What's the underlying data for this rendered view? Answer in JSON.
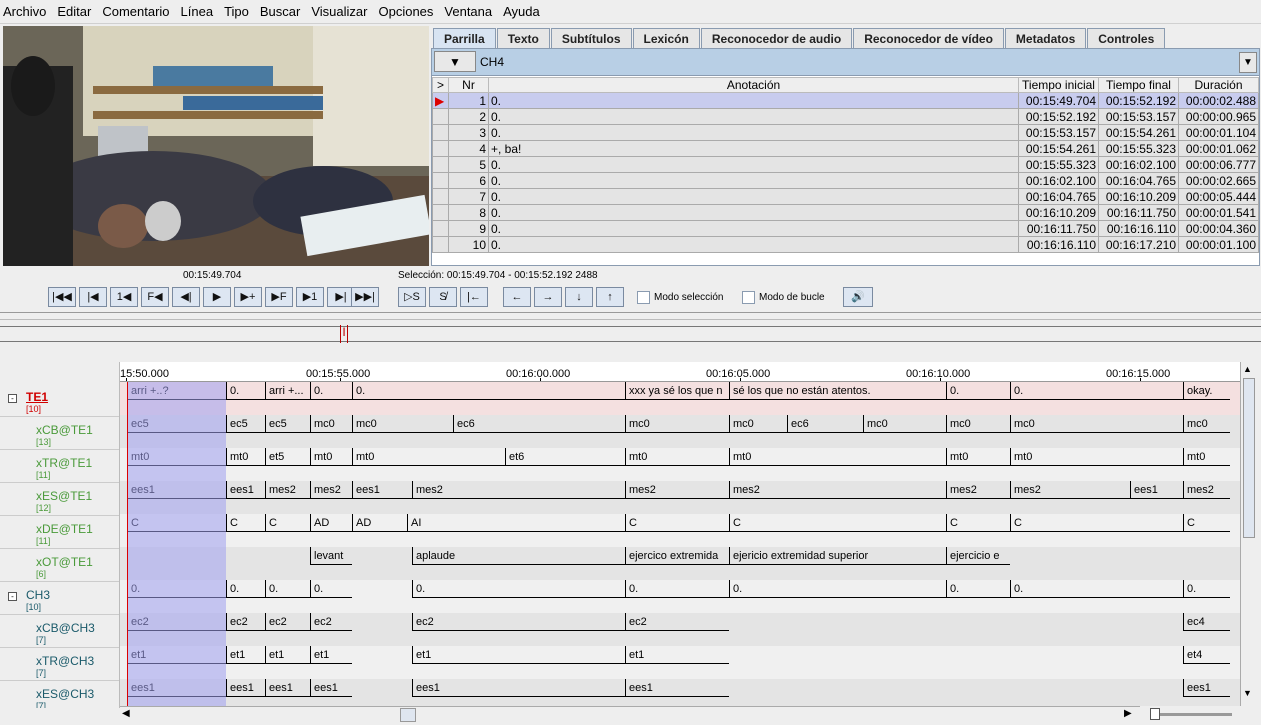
{
  "menu": [
    "Archivo",
    "Editar",
    "Comentario",
    "Línea",
    "Tipo",
    "Buscar",
    "Visualizar",
    "Opciones",
    "Ventana",
    "Ayuda"
  ],
  "tabs": [
    "Parrilla",
    "Texto",
    "Subtítulos",
    "Lexicón",
    "Reconocedor de audio",
    "Reconocedor de vídeo",
    "Metadatos",
    "Controles"
  ],
  "grid": {
    "tier": "CH4",
    "headers": {
      "arrow": ">",
      "nr": "Nr",
      "annotation": "Anotación",
      "begin": "Tiempo inicial",
      "end": "Tiempo final",
      "duration": "Duración"
    },
    "rows": [
      {
        "nr": "1",
        "annotation": "0.",
        "begin": "00:15:49.704",
        "end": "00:15:52.192",
        "duration": "00:00:02.488"
      },
      {
        "nr": "2",
        "annotation": "0.",
        "begin": "00:15:52.192",
        "end": "00:15:53.157",
        "duration": "00:00:00.965"
      },
      {
        "nr": "3",
        "annotation": "0.",
        "begin": "00:15:53.157",
        "end": "00:15:54.261",
        "duration": "00:00:01.104"
      },
      {
        "nr": "4",
        "annotation": "+, ba!",
        "begin": "00:15:54.261",
        "end": "00:15:55.323",
        "duration": "00:00:01.062"
      },
      {
        "nr": "5",
        "annotation": "0.",
        "begin": "00:15:55.323",
        "end": "00:16:02.100",
        "duration": "00:00:06.777"
      },
      {
        "nr": "6",
        "annotation": "0.",
        "begin": "00:16:02.100",
        "end": "00:16:04.765",
        "duration": "00:00:02.665"
      },
      {
        "nr": "7",
        "annotation": "0.",
        "begin": "00:16:04.765",
        "end": "00:16:10.209",
        "duration": "00:00:05.444"
      },
      {
        "nr": "8",
        "annotation": "0.",
        "begin": "00:16:10.209",
        "end": "00:16:11.750",
        "duration": "00:00:01.541"
      },
      {
        "nr": "9",
        "annotation": "0.",
        "begin": "00:16:11.750",
        "end": "00:16:16.110",
        "duration": "00:00:04.360"
      },
      {
        "nr": "10",
        "annotation": "0.",
        "begin": "00:16:16.110",
        "end": "00:16:17.210",
        "duration": "00:00:01.100"
      }
    ]
  },
  "media": {
    "current_time": "00:15:49.704",
    "selection": "Selección: 00:15:49.704 - 00:15:52.192  2488",
    "selection_mode_label": "Modo selección",
    "loop_mode_label": "Modo de bucle"
  },
  "ruler": [
    "15:50.000",
    "00:15:55.000",
    "00:16:00.000",
    "00:16:05.000",
    "00:16:10.000",
    "00:16:15.000"
  ],
  "tiers": [
    {
      "name": "TE1",
      "count": "[10]",
      "color": "#d00000"
    },
    {
      "name": "xCB@TE1",
      "count": "[13]",
      "color": "#4a9a3a"
    },
    {
      "name": "xTR@TE1",
      "count": "[11]",
      "color": "#4a9a3a"
    },
    {
      "name": "xES@TE1",
      "count": "[12]",
      "color": "#4a9a3a"
    },
    {
      "name": "xDE@TE1",
      "count": "[11]",
      "color": "#4a9a3a"
    },
    {
      "name": "xOT@TE1",
      "count": "[6]",
      "color": "#4a9a3a"
    },
    {
      "name": "CH3",
      "count": "[10]",
      "color": "#1a5a6a"
    },
    {
      "name": "xCB@CH3",
      "count": "[7]",
      "color": "#1a5a6a"
    },
    {
      "name": "xTR@CH3",
      "count": "[7]",
      "color": "#1a5a6a"
    },
    {
      "name": "xES@CH3",
      "count": "[7]",
      "color": "#1a5a6a"
    }
  ],
  "track_rows": [
    [
      "arri +..?",
      "0.",
      "arri +...",
      "0.",
      "0.",
      "xxx ya sé los que n",
      "sé los que no están atentos.",
      "0.",
      "0.",
      "okay."
    ],
    [
      "ec5",
      "ec5",
      "ec5",
      "mc0",
      "mc0",
      "ec6",
      "mc0",
      "mc0",
      "ec6",
      "mc0",
      "mc0",
      "mc0",
      "mc0"
    ],
    [
      "mt0",
      "mt0",
      "et5",
      "mt0",
      "mt0",
      "et6",
      "mt0",
      "mt0",
      "mt0",
      "mt0",
      "mt0"
    ],
    [
      "ees1",
      "ees1",
      "mes2",
      "mes2",
      "ees1",
      "mes2",
      "mes2",
      "mes2",
      "mes2",
      "mes2",
      "ees1",
      "mes2"
    ],
    [
      "C",
      "C",
      "C",
      "AD",
      "AD",
      "AI",
      "C",
      "C",
      "C",
      "C",
      "C"
    ],
    [
      "levant",
      "aplaude",
      "ejercico extremida",
      "ejericio extremidad superior",
      "ejercicio e"
    ],
    [
      "0.",
      "0.",
      "0.",
      "0.",
      "0.",
      "0.",
      "0.",
      "0.",
      "0.",
      "0."
    ],
    [
      "ec2",
      "ec2",
      "ec2",
      "ec2",
      "ec2",
      "ec2",
      "ec4"
    ],
    [
      "et1",
      "et1",
      "et1",
      "et1",
      "et1",
      "et1",
      "et4"
    ],
    [
      "ees1",
      "ees1",
      "ees1",
      "ees1",
      "ees1",
      "ees1",
      "ees1"
    ]
  ],
  "colors": {
    "accent": "#b8cfe5",
    "selection": "#c8ccee",
    "cursor": "#dd0000"
  }
}
